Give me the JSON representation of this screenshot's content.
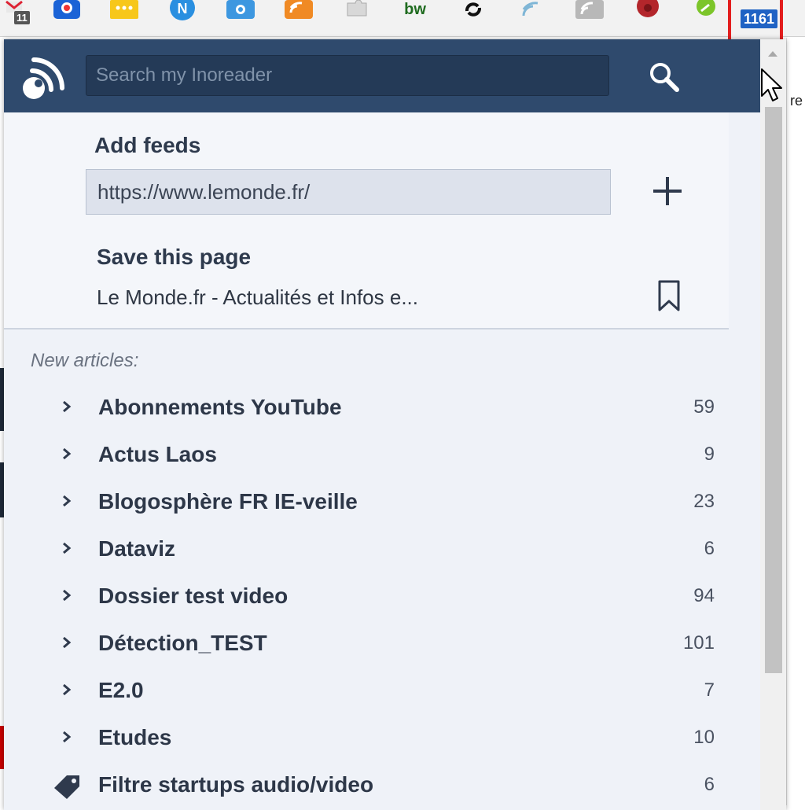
{
  "toolbar": {
    "first_badge": "11",
    "inoreader_badge": "1161"
  },
  "background_page": {
    "peek_text": "re"
  },
  "popup": {
    "search": {
      "placeholder": "Search my Inoreader"
    },
    "add_feeds": {
      "title": "Add feeds",
      "url_value": "https://www.lemonde.fr/"
    },
    "save_page": {
      "title": "Save this page",
      "page_title": "Le Monde.fr - Actualités et Infos e..."
    },
    "new_articles_label": "New articles:",
    "feeds": [
      {
        "name": "Abonnements YouTube",
        "count": "59",
        "icon": "chevron-right-icon"
      },
      {
        "name": "Actus Laos",
        "count": "9",
        "icon": "chevron-right-icon"
      },
      {
        "name": "Blogosphère FR IE-veille",
        "count": "23",
        "icon": "chevron-right-icon"
      },
      {
        "name": "Dataviz",
        "count": "6",
        "icon": "chevron-right-icon"
      },
      {
        "name": "Dossier test video",
        "count": "94",
        "icon": "chevron-right-icon"
      },
      {
        "name": "Détection_TEST",
        "count": "101",
        "icon": "chevron-right-icon"
      },
      {
        "name": "E2.0",
        "count": "7",
        "icon": "chevron-right-icon"
      },
      {
        "name": "Etudes",
        "count": "10",
        "icon": "chevron-right-icon"
      },
      {
        "name": "Filtre startups audio/video",
        "count": "6",
        "icon": "tag-icon"
      }
    ]
  },
  "colors": {
    "header": "#2f4a6d",
    "popup_bg": "#eff2f8",
    "badge_blue": "#1f62c4",
    "highlight_red": "#e31e1e"
  }
}
